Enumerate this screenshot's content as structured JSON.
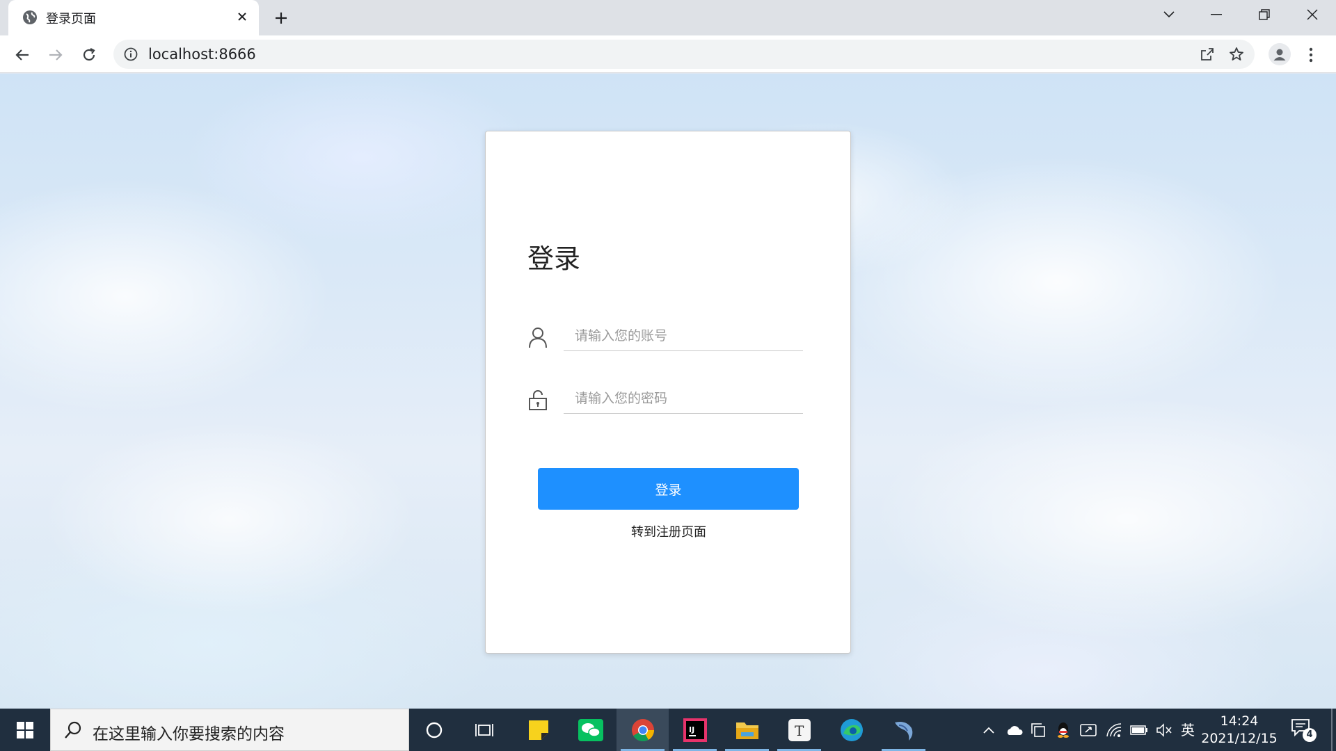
{
  "browser": {
    "tab_title": "登录页面",
    "url": "localhost:8666"
  },
  "page": {
    "title": "登录",
    "username_placeholder": "请输入您的账号",
    "password_placeholder": "请输入您的密码",
    "login_button": "登录",
    "register_link": "转到注册页面"
  },
  "taskbar": {
    "search_placeholder": "在这里输入你要搜索的内容",
    "apps": [
      "cortana-icon",
      "task-view-icon",
      "sticky-notes-icon",
      "wechat-icon",
      "chrome-icon",
      "intellij-icon",
      "file-explorer-icon",
      "typora-icon",
      "edge-icon",
      "mysql-icon"
    ],
    "ime": "英",
    "time": "14:24",
    "date": "2021/12/15",
    "notification_count": "4"
  },
  "colors": {
    "accent": "#1e90ff",
    "taskbar": "#202f3f"
  }
}
